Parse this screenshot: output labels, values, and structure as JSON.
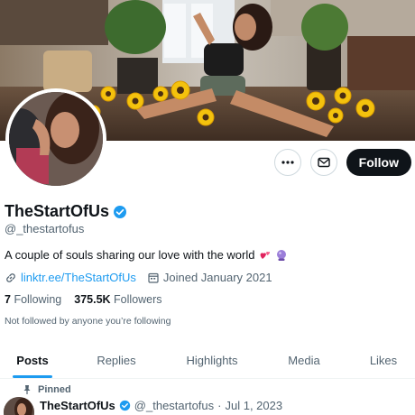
{
  "profile": {
    "display_name": "TheStartOfUs",
    "handle": "@_thestartofus",
    "bio": "A couple of souls sharing our love with the world",
    "bio_emojis": [
      "two-hearts-icon",
      "crystal-ball-icon"
    ],
    "link": "linktr.ee/TheStartOfUs",
    "joined": "Joined January 2021",
    "following_count": "7",
    "following_label": "Following",
    "followers_count": "375.5K",
    "followers_label": "Followers",
    "not_followed_text": "Not followed by anyone you’re following",
    "verified_color": "#1d9bf0"
  },
  "actions": {
    "more_icon": "more-icon",
    "message_icon": "envelope-icon",
    "follow_label": "Follow"
  },
  "tabs": [
    {
      "label": "Posts",
      "active": true
    },
    {
      "label": "Replies",
      "active": false
    },
    {
      "label": "Highlights",
      "active": false
    },
    {
      "label": "Media",
      "active": false
    },
    {
      "label": "Likes",
      "active": false
    }
  ],
  "pinned_post": {
    "pinned_label": "Pinned",
    "author_name": "TheStartOfUs",
    "author_handle": "@_thestartofus",
    "date": "Jul 1, 2023"
  },
  "colors": {
    "accent": "#1d9bf0",
    "text": "#0f1419",
    "muted": "#536471",
    "follow_bg": "#0f1419"
  }
}
